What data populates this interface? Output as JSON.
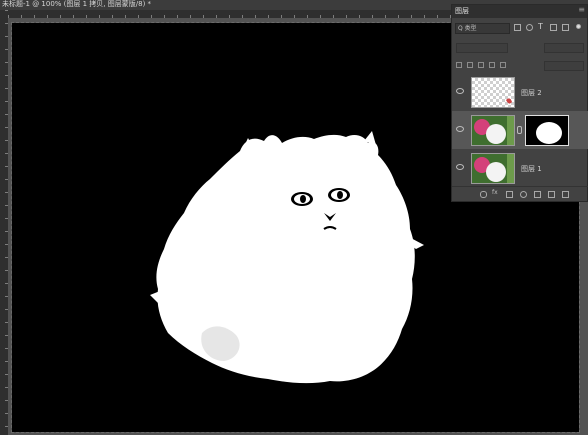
{
  "document": {
    "title": "未标题-1 @ 100% (图层 1 拷贝, 图层蒙版/8) *"
  },
  "panel": {
    "tab": "图层",
    "filter": {
      "kind_label": "Q 类型"
    },
    "layers": [
      {
        "name": "图层 2",
        "visible": true,
        "thumbnail": "transparent"
      },
      {
        "name": "",
        "visible": true,
        "thumbnail": "photo",
        "has_mask": true,
        "selected": true
      },
      {
        "name": "图层 1",
        "visible": true,
        "thumbnail": "photo"
      }
    ],
    "bottom_icons": [
      "link-icon",
      "fx-icon",
      "mask-icon",
      "adjustment-icon",
      "group-icon",
      "new-layer-icon",
      "trash-icon"
    ],
    "fx_label": "fx"
  },
  "colors": {
    "canvas": "#000000",
    "workspace": "#535353",
    "panel": "#424242",
    "selected_row": "#575757"
  }
}
